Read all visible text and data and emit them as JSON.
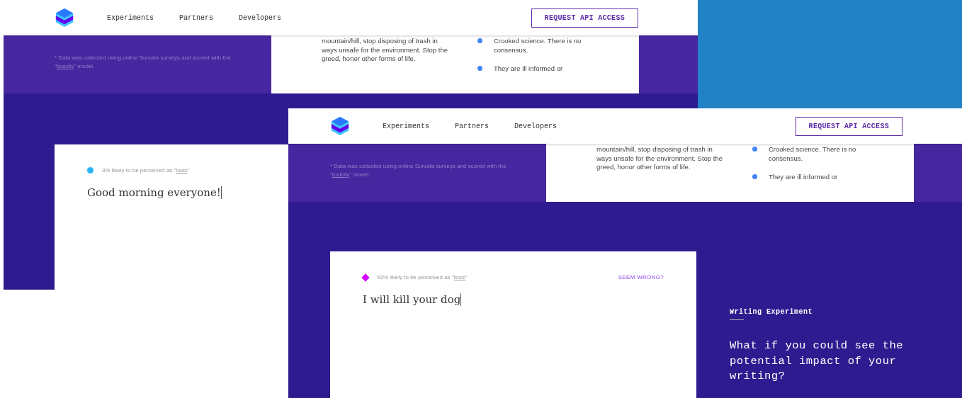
{
  "screenshots": [
    {
      "nav": {
        "links": [
          "Experiments",
          "Partners",
          "Developers"
        ],
        "button": "REQUEST API ACCESS"
      },
      "footnote": {
        "before": "* Data was collected using online Survata surveys and scored with the \"",
        "link": "toxicity",
        "after": "\" model."
      },
      "comment": "mountain/hill, stop disposing of trash in ways unsafe for the environment. Stop the greed, honor other forms of life.",
      "bullets": [
        "Crooked science. There is no consensus.",
        "They are ill informed or"
      ],
      "experiment": {
        "score": {
          "kind": "circle",
          "color": "#29b6f6",
          "before": "3% likely to be perceived as \"",
          "link": "toxic",
          "after": "\""
        },
        "input": "Good morning everyone!"
      }
    },
    {
      "nav": {
        "links": [
          "Experiments",
          "Partners",
          "Developers"
        ],
        "button": "REQUEST API ACCESS"
      },
      "footnote": {
        "before": "* Data was collected using online Survata surveys and scored with the \"",
        "link": "toxicity",
        "after": "\" model."
      },
      "comment": "mountain/hill, stop disposing of trash in ways unsafe for the environment. Stop the greed, honor other forms of life.",
      "bullets": [
        "Crooked science. There is no consensus.",
        "They are ill informed or"
      ],
      "experiment": {
        "score": {
          "kind": "diamond",
          "color": "#d500f9",
          "before": "93% likely to be perceived as \"",
          "link": "toxic",
          "after": "\""
        },
        "action": "SEEM WRONG?",
        "input": "I will kill your dog"
      },
      "intro": {
        "eyebrow": "Writing Experiment",
        "headline": "What if you could see the potential impact of your writing?"
      }
    }
  ]
}
